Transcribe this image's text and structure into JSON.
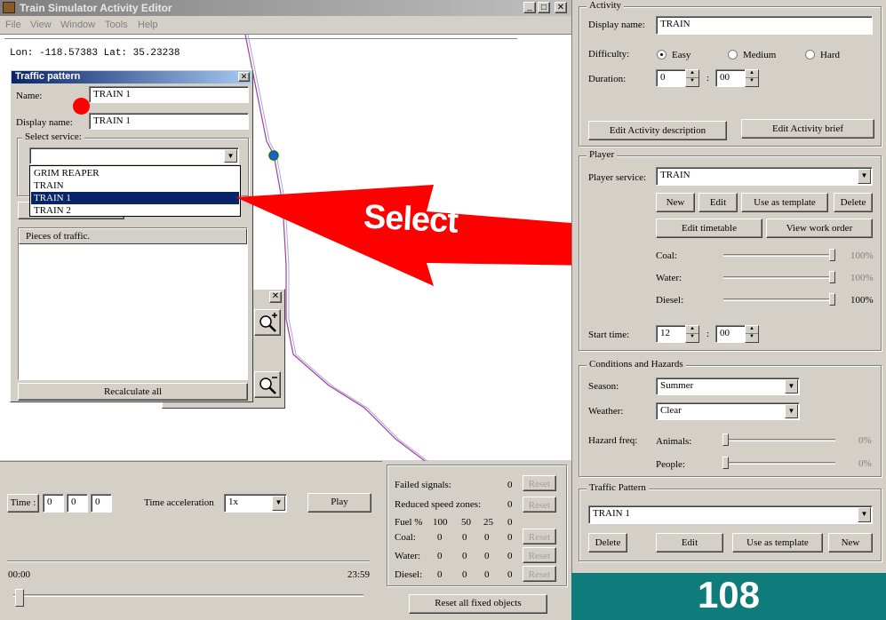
{
  "window": {
    "title": "Train Simulator Activity Editor"
  },
  "menu": [
    "File",
    "View",
    "Window",
    "Tools",
    "Help"
  ],
  "coords": "Lon: -118.57383 Lat: 35.23238",
  "traffic_dialog": {
    "title": "Traffic pattern",
    "name_label": "Name:",
    "name_value": "TRAIN 1",
    "display_label": "Display name:",
    "display_value": "TRAIN 1",
    "service_group": "Select service:",
    "service_value": "",
    "options": [
      "GRIM REAPER",
      "TRAIN",
      "TRAIN 1",
      "TRAIN 2"
    ],
    "selected_index": 2,
    "pieces_header": "Pieces of traffic.",
    "recalc_label": "Recalculate all"
  },
  "zoom_panel": {},
  "callout": {
    "text": "Select"
  },
  "bottom": {
    "time_label": "Time :",
    "time_values": [
      "0",
      "0",
      "0"
    ],
    "accel_label": "Time acceleration",
    "accel_value": "1x",
    "play_label": "Play",
    "time_start": "00:00",
    "time_end": "23:59"
  },
  "failures": {
    "failed_signals_label": "Failed signals:",
    "failed_signals_value": "0",
    "speed_zones_label": "Reduced speed zones:",
    "speed_zones_value": "0",
    "fuel_label": "Fuel %",
    "fuel_headers": [
      "100",
      "50",
      "25",
      "0"
    ],
    "rows": [
      {
        "label": "Coal:",
        "values": [
          "0",
          "0",
          "0",
          "0"
        ]
      },
      {
        "label": "Water:",
        "values": [
          "0",
          "0",
          "0",
          "0"
        ]
      },
      {
        "label": "Diesel:",
        "values": [
          "0",
          "0",
          "0",
          "0"
        ]
      }
    ],
    "reset_label": "Reset",
    "reset_all_label": "Reset all fixed objects"
  },
  "activity": {
    "title": "Activity",
    "display_label": "Display name:",
    "display_value": "TRAIN",
    "difficulty_label": "Difficulty:",
    "difficulties": [
      "Easy",
      "Medium",
      "Hard"
    ],
    "difficulty_selected": "Easy",
    "duration_label": "Duration:",
    "duration_hours": "0",
    "duration_minutes": "00",
    "edit_desc_label": "Edit Activity description",
    "edit_brief_label": "Edit Activity brief"
  },
  "player": {
    "title": "Player",
    "service_label": "Player service:",
    "service_value": "TRAIN",
    "new_label": "New",
    "edit_label": "Edit",
    "template_label": "Use as template",
    "delete_label": "Delete",
    "timetable_label": "Edit timetable",
    "workorder_label": "View work order",
    "coal_label": "Coal:",
    "coal_value": "100%",
    "water_label": "Water:",
    "water_value": "100%",
    "diesel_label": "Diesel:",
    "diesel_value": "100%",
    "start_label": "Start time:",
    "start_hours": "12",
    "start_minutes": "00"
  },
  "conditions": {
    "title": "Conditions and Hazards",
    "season_label": "Season:",
    "season_value": "Summer",
    "weather_label": "Weather:",
    "weather_value": "Clear",
    "hazard_label": "Hazard freq:",
    "animals_label": "Animals:",
    "animals_value": "0%",
    "people_label": "People:",
    "people_value": "0%"
  },
  "traffic_pattern": {
    "title": "Traffic Pattern",
    "value": "TRAIN 1",
    "delete_label": "Delete",
    "edit_label": "Edit",
    "template_label": "Use as template",
    "new_label": "New"
  },
  "page_number": "108",
  "colors": {
    "accent_teal": "#0e7c7a",
    "title_blue": "#0a246a",
    "arrow_red": "#ff0000"
  }
}
